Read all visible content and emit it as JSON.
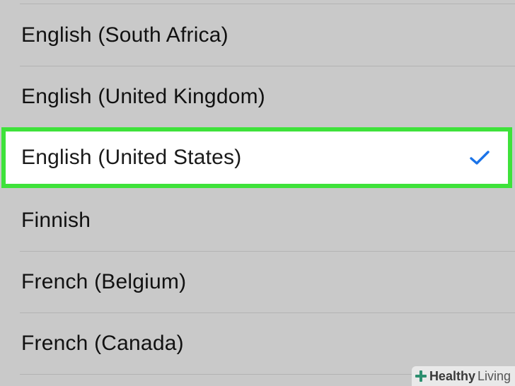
{
  "language_list": {
    "items": [
      {
        "label": "English (South Africa)",
        "selected": false
      },
      {
        "label": "English (United Kingdom)",
        "selected": false
      },
      {
        "label": "English (United States)",
        "selected": true
      },
      {
        "label": "Finnish",
        "selected": false
      },
      {
        "label": "French (Belgium)",
        "selected": false
      },
      {
        "label": "French (Canada)",
        "selected": false
      }
    ],
    "check_icon": "checkmark-icon",
    "check_color": "#1a73e8",
    "highlight_color": "#3ee23a"
  },
  "watermark": {
    "word1": "Healthy",
    "word2": "Living",
    "logo_icon": "cross-logo-icon",
    "logo_color": "#2d8f6f"
  }
}
